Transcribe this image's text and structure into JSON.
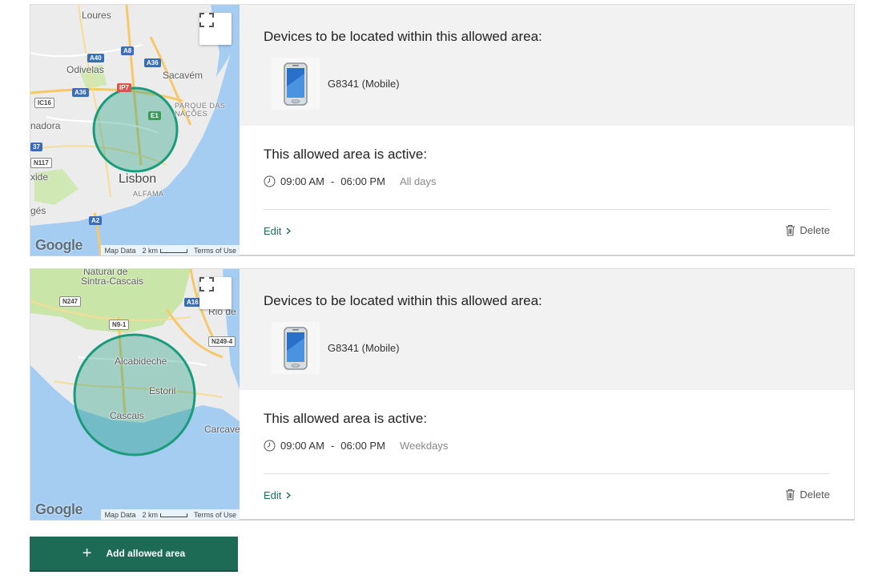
{
  "colors": {
    "brand": "#1e6b55",
    "geofence": "#1a9b7c",
    "water": "#a5cdf2",
    "land": "#ececec",
    "park": "#c9e6a8"
  },
  "areas": [
    {
      "map": {
        "labels": [
          "Loures",
          "Odivelas",
          "Sacavém",
          "PARQUE DAS",
          "NAÇÕES",
          "nadora",
          "xide",
          "Lisbon",
          "ALFAMA",
          "gés"
        ],
        "shields": [
          "A8",
          "A40",
          "A36",
          "A36",
          "IP7",
          "IC16",
          "E1",
          "37",
          "N117",
          "A2"
        ],
        "google": "Google",
        "map_data": "Map Data",
        "scale": "2 km",
        "terms": "Terms of Use"
      },
      "devices_title": "Devices to be located within this allowed area:",
      "device": {
        "label": "G8341 (Mobile)",
        "icon": "smartphone-icon"
      },
      "active_title": "This allowed area is active:",
      "start": "09:00 AM",
      "dash": "-",
      "end": "06:00 PM",
      "days": "All days",
      "edit_label": "Edit",
      "delete_label": "Delete"
    },
    {
      "map": {
        "labels": [
          "Natural de",
          "Sintra-Cascais",
          "Rio de",
          "Alcabideche",
          "Estoril",
          "Cascais",
          "Carcave"
        ],
        "shields": [
          "N247",
          "A16",
          "N9-1",
          "N249-4"
        ],
        "google": "Google",
        "map_data": "Map Data",
        "scale": "2 km",
        "terms": "Terms of Use"
      },
      "devices_title": "Devices to be located within this allowed area:",
      "device": {
        "label": "G8341 (Mobile)",
        "icon": "smartphone-icon"
      },
      "active_title": "This allowed area is active:",
      "start": "09:00 AM",
      "dash": "-",
      "end": "06:00 PM",
      "days": "Weekdays",
      "edit_label": "Edit",
      "delete_label": "Delete"
    }
  ],
  "add_button": {
    "label": "Add allowed area",
    "plus": "+"
  }
}
